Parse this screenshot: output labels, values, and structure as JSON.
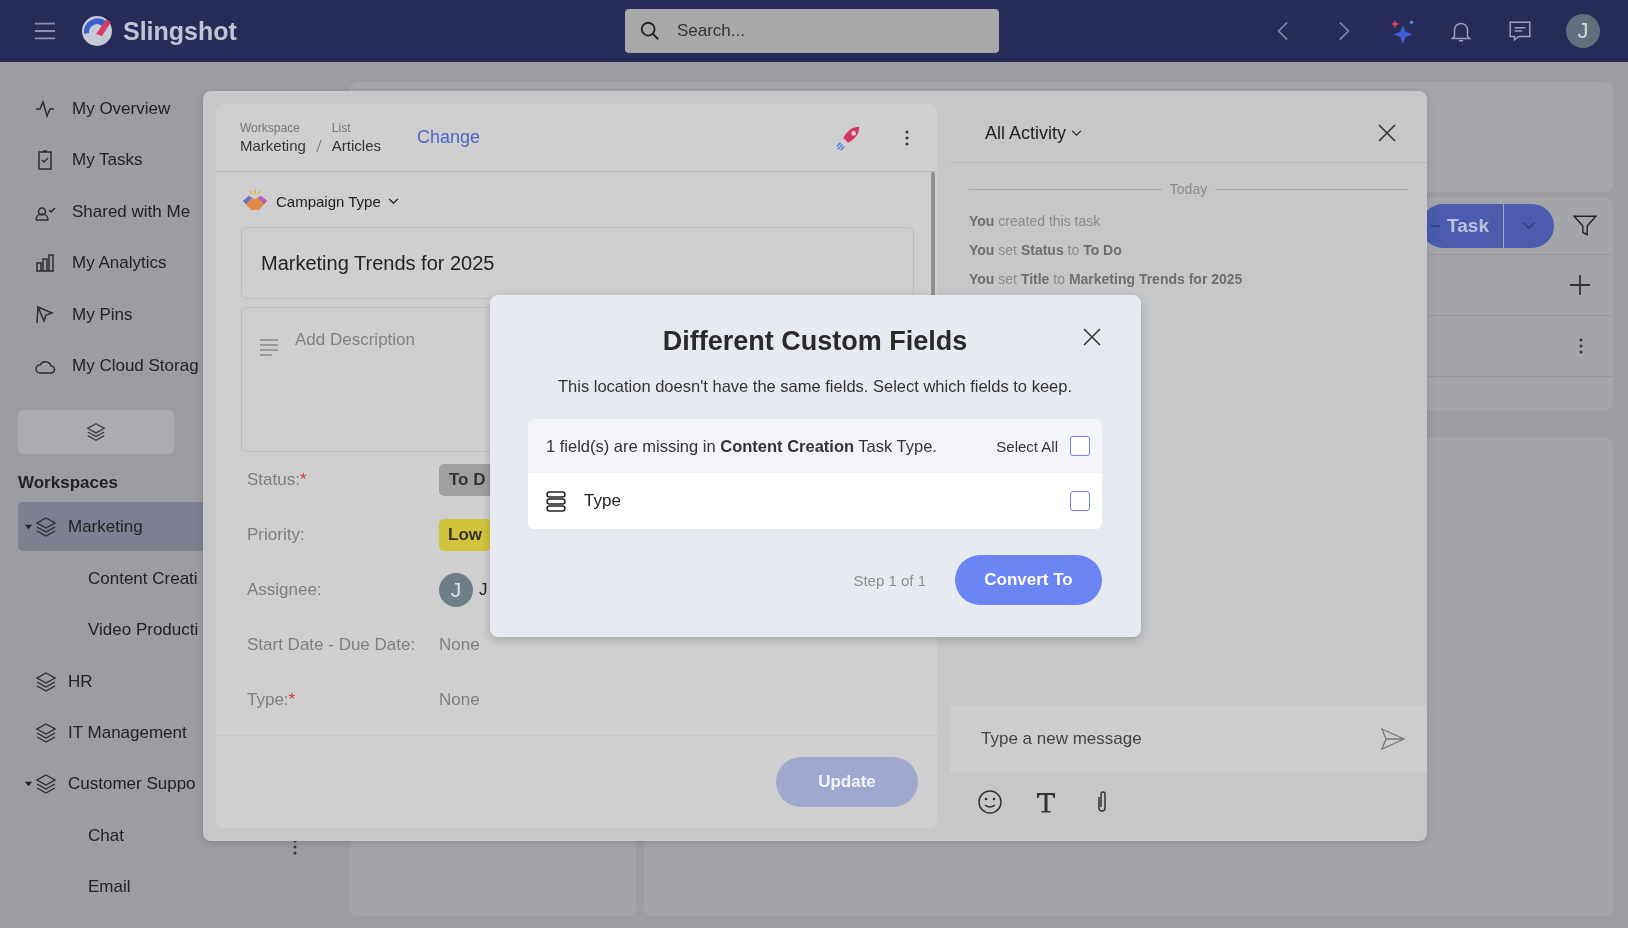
{
  "header": {
    "brand": "Slingshot",
    "search": {
      "placeholder": "Search..."
    },
    "avatar": "J"
  },
  "sidebar": {
    "items": [
      {
        "label": "My Overview"
      },
      {
        "label": "My Tasks"
      },
      {
        "label": "Shared with Me"
      },
      {
        "label": "My Analytics"
      },
      {
        "label": "My Pins"
      },
      {
        "label": "My Cloud Storag"
      }
    ],
    "workspaces_title": "Workspaces",
    "workspaces": [
      {
        "label": "Marketing",
        "selected": true,
        "expanded": true,
        "children": [
          {
            "label": "Content Creati"
          },
          {
            "label": "Video Producti"
          }
        ]
      },
      {
        "label": "HR",
        "selected": false,
        "expanded": false
      },
      {
        "label": "IT Management",
        "selected": false,
        "expanded": false
      },
      {
        "label": "Customer Suppo",
        "selected": false,
        "expanded": true,
        "children": [
          {
            "label": "Chat"
          },
          {
            "label": "Email"
          }
        ]
      }
    ]
  },
  "background": {
    "task_button": "Task"
  },
  "task": {
    "breadcrumb": {
      "workspace_label": "Workspace",
      "workspace": "Marketing",
      "list_label": "List",
      "list": "Articles"
    },
    "change": "Change",
    "type_selector": "Campaign Type",
    "title": "Marketing Trends for 2025",
    "description": {
      "placeholder": "Add Description"
    },
    "fields": [
      {
        "label": "Status:",
        "required_mark": "*",
        "kind": "status",
        "value": "To D"
      },
      {
        "label": "Priority:",
        "kind": "priority",
        "value": "Low"
      },
      {
        "label": "Assignee:",
        "kind": "person",
        "avatar": "J",
        "value": "J"
      },
      {
        "label": "Start Date - Due Date:",
        "kind": "text",
        "value": "None"
      },
      {
        "label": "Type:",
        "required_mark": "*",
        "kind": "text",
        "value": "None"
      }
    ],
    "update_button": {
      "label": "Update",
      "disabled": true
    }
  },
  "activity": {
    "filter": "All Activity",
    "divider": "Today",
    "entries": [
      "**You** created this task",
      "**You** set **Status** to **To Do**",
      "**You** set **Title** to **Marketing Trends for 2025**"
    ],
    "message": {
      "placeholder": "Type a new message"
    }
  },
  "dialog": {
    "title": "Different Custom Fields",
    "text": "This location doesn't have the same fields. Select which fields to keep.",
    "missing": "1 field(s) are missing in **Content Creation** Task Type.",
    "select_all": {
      "label": "Select All",
      "checked": false
    },
    "fields": [
      {
        "label": "Type",
        "checked": false
      }
    ],
    "step": "Step 1 of 1",
    "button": "Convert To"
  }
}
